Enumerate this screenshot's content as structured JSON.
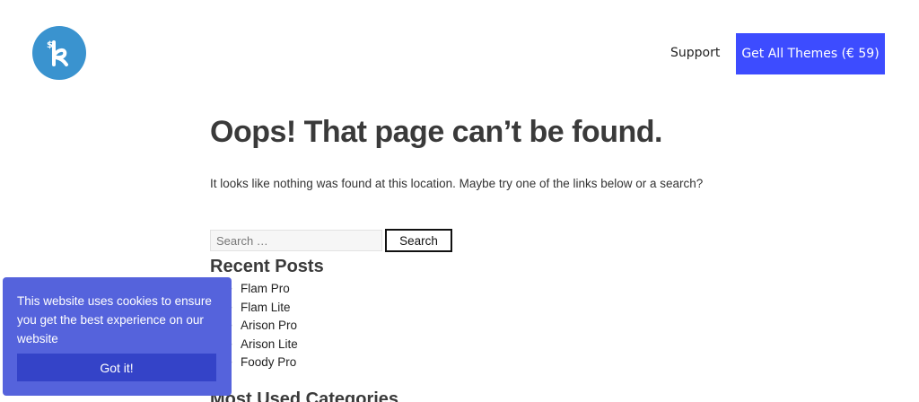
{
  "header": {
    "logo_icon": "k-logo-icon",
    "logo_color": "#3a93cf",
    "support_label": "Support",
    "cta_label": "Get All Themes (€ 59)",
    "cta_color": "#3d4cff"
  },
  "main": {
    "title": "Oops! That page can’t be found.",
    "intro": "It looks like nothing was found at this location. Maybe try one of the links below or a search?",
    "search": {
      "placeholder": "Search …",
      "button_label": "Search"
    },
    "recent_posts": {
      "heading": "Recent Posts",
      "items": [
        "Flam Pro",
        "Flam Lite",
        "Arison Pro",
        "Arison Lite",
        "Foody Pro"
      ]
    },
    "categories": {
      "heading": "Most Used Categories"
    }
  },
  "cookie": {
    "text": "This website uses cookies to ensure you get the best experience on our website",
    "button_label": "Got it!",
    "bg_color": "#5563dc"
  }
}
